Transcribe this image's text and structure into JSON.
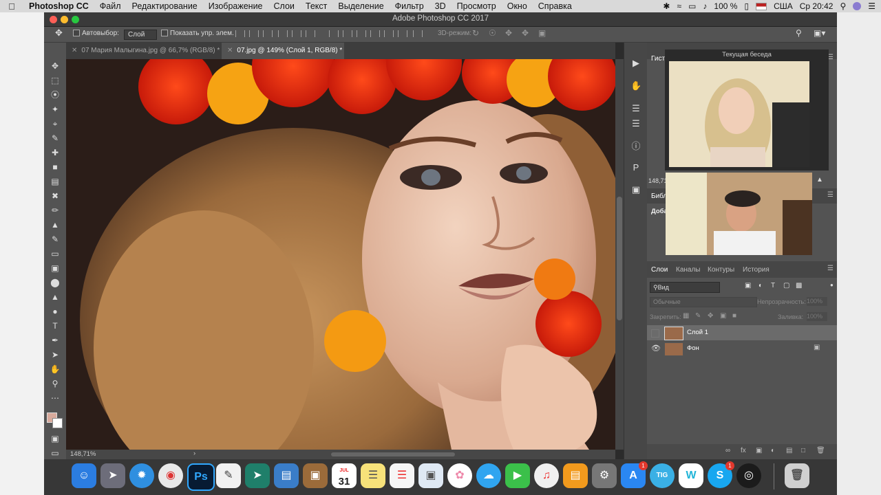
{
  "menubar": {
    "app": "Photoshop CC",
    "items": [
      "Файл",
      "Редактирование",
      "Изображение",
      "Слои",
      "Текст",
      "Выделение",
      "Фильтр",
      "3D",
      "Просмотр",
      "Окно",
      "Справка"
    ],
    "battery": "100 %",
    "locale": "США",
    "clock": "Ср 20:42"
  },
  "window": {
    "title": "Adobe Photoshop CC 2017"
  },
  "options": {
    "autoselect_label": "Автовыбор:",
    "autoselect_value": "Слой",
    "show_transform_label": "Показать упр. элем.",
    "mode3d_label": "3D-режим:"
  },
  "tabs": [
    {
      "label": "07 Мария Малыгина.jpg @ 66,7% (RGB/8) *"
    },
    {
      "label": "07.jpg @ 149% (Слой 1, RGB/8) *"
    }
  ],
  "status": {
    "zoom": "148,71%"
  },
  "panels": {
    "histogram_tab": "Гисто",
    "zoom_readout": "148,71",
    "libraries_tab": "Библ",
    "add_label": "Добав"
  },
  "videocall": {
    "title": "Текущая беседа"
  },
  "layers": {
    "tabs": [
      "Слои",
      "Каналы",
      "Контуры",
      "История"
    ],
    "filter_label": "Вид",
    "blend_mode": "Обычные",
    "opacity_label": "Непрозрачность:",
    "opacity_value": "100%",
    "lock_label": "Закрепить:",
    "fill_label": "Заливка:",
    "fill_value": "100%",
    "items": [
      {
        "name": "Слой 1",
        "visible": false,
        "selected": true
      },
      {
        "name": "Фон",
        "visible": true,
        "locked": true
      }
    ]
  },
  "dock": {
    "ps_label": "Ps",
    "calendar_month": "JUL",
    "calendar_day": "31",
    "tig_label": "TIG",
    "w_label": "W",
    "badge_appstore": "1",
    "badge_skype": "1"
  }
}
